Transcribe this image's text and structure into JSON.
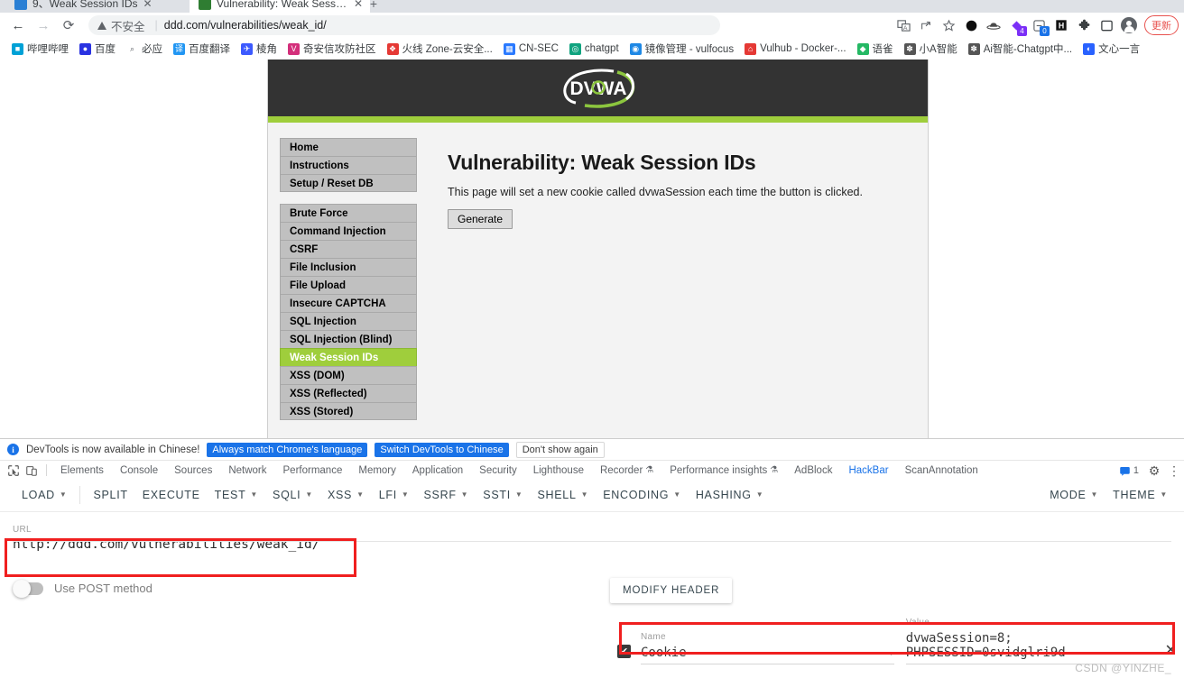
{
  "browser": {
    "tabs": [
      {
        "title": "9、Weak Session IDs",
        "active": false,
        "favicon": "blue-favicon"
      },
      {
        "title": "Vulnerability: Weak Session ID",
        "active": true,
        "favicon": "green-favicon"
      }
    ],
    "new_tab_label": "+",
    "nav": {
      "back": "←",
      "forward": "→",
      "reload": "⟳"
    },
    "omnibox": {
      "security_text": "不安全",
      "divider": "|",
      "url": "ddd.com/vulnerabilities/weak_id/"
    },
    "toolbar_icons": [
      {
        "name": "translate-icon",
        "glyph": "⟨⟩"
      },
      {
        "name": "share-icon",
        "glyph": "↗"
      },
      {
        "name": "bookmark-star-icon",
        "glyph": "☆"
      },
      {
        "name": "extension-opera-icon",
        "glyph": "⬤"
      },
      {
        "name": "extension-hat-icon",
        "glyph": "◝"
      },
      {
        "name": "extension-purple-icon",
        "glyph": "◆",
        "badge": "4",
        "badge_color": "#7b2ff7"
      },
      {
        "name": "extension-scan-icon",
        "glyph": "▦",
        "badge": "0",
        "badge_color": "#1a73e8"
      },
      {
        "name": "extension-hackbar-icon",
        "glyph": "H"
      },
      {
        "name": "extensions-puzzle-icon",
        "glyph": "✻"
      },
      {
        "name": "sidepanel-icon",
        "glyph": "□"
      },
      {
        "name": "profile-avatar",
        "glyph": ""
      }
    ],
    "update_button": "更新",
    "bookmarks": [
      {
        "label": "哔哩哔哩",
        "icon": "bilibili-icon",
        "glyph": "■",
        "color": "#00a1d6"
      },
      {
        "label": "百度",
        "icon": "baidu-icon",
        "glyph": "●",
        "color": "#2932e1"
      },
      {
        "label": "必应",
        "icon": "bing-search-icon",
        "glyph": "⌕",
        "color": "#5f6368"
      },
      {
        "label": "百度翻译",
        "icon": "translate-icon",
        "glyph": "译",
        "color": "#2196f3"
      },
      {
        "label": "棱角",
        "icon": "lengjiao-icon",
        "glyph": "✈",
        "color": "#3d5afe"
      },
      {
        "label": "奇安信攻防社区",
        "icon": "qianxin-icon",
        "glyph": "V",
        "color": "#d32f7b"
      },
      {
        "label": "火线 Zone-云安全...",
        "icon": "huoxian-icon",
        "glyph": "❖",
        "color": "#e53935"
      },
      {
        "label": "CN-SEC",
        "icon": "cnsec-icon",
        "glyph": "▦",
        "color": "#2979ff"
      },
      {
        "label": "chatgpt",
        "icon": "chatgpt-icon",
        "glyph": "◎",
        "color": "#10a37f"
      },
      {
        "label": "镜像管理 - vulfocus",
        "icon": "vulfocus-icon",
        "glyph": "◉",
        "color": "#1e88e5"
      },
      {
        "label": "Vulhub - Docker-...",
        "icon": "vulhub-icon",
        "glyph": "⌂",
        "color": "#e53935"
      },
      {
        "label": "语雀",
        "icon": "yuque-icon",
        "glyph": "◆",
        "color": "#25b864"
      },
      {
        "label": "小A智能",
        "icon": "xiaoa-icon",
        "glyph": "✽",
        "color": "#555555"
      },
      {
        "label": "Ai智能-Chatgpt中...",
        "icon": "ai-chatgpt-icon",
        "glyph": "✽",
        "color": "#555555"
      },
      {
        "label": "文心一言",
        "icon": "wenxin-icon",
        "glyph": "◐",
        "color": "#2962ff"
      }
    ]
  },
  "dvwa": {
    "logo_text": "DVWA",
    "nav_primary": [
      {
        "label": "Home"
      },
      {
        "label": "Instructions"
      },
      {
        "label": "Setup / Reset DB"
      }
    ],
    "nav_vulns": [
      {
        "label": "Brute Force",
        "active": false
      },
      {
        "label": "Command Injection",
        "active": false
      },
      {
        "label": "CSRF",
        "active": false
      },
      {
        "label": "File Inclusion",
        "active": false
      },
      {
        "label": "File Upload",
        "active": false
      },
      {
        "label": "Insecure CAPTCHA",
        "active": false
      },
      {
        "label": "SQL Injection",
        "active": false
      },
      {
        "label": "SQL Injection (Blind)",
        "active": false
      },
      {
        "label": "Weak Session IDs",
        "active": true
      },
      {
        "label": "XSS (DOM)",
        "active": false
      },
      {
        "label": "XSS (Reflected)",
        "active": false
      },
      {
        "label": "XSS (Stored)",
        "active": false
      }
    ],
    "heading": "Vulnerability: Weak Session IDs",
    "description": "This page will set a new cookie called dvwaSession each time the button is clicked.",
    "generate_button": "Generate",
    "accent_green": "#9fce3c",
    "header_dark": "#333333"
  },
  "devtools": {
    "notice": {
      "message": "DevTools is now available in Chinese!",
      "primary_button": "Always match Chrome's language",
      "secondary_button": "Switch DevTools to Chinese",
      "dismiss_button": "Don't show again",
      "info_glyph": "i"
    },
    "left_icons": [
      {
        "name": "inspect-element-icon",
        "glyph": "⬚"
      },
      {
        "name": "device-toolbar-icon",
        "glyph": "◱"
      }
    ],
    "tabs": [
      {
        "label": "Elements",
        "selected": false
      },
      {
        "label": "Console",
        "selected": false
      },
      {
        "label": "Sources",
        "selected": false
      },
      {
        "label": "Network",
        "selected": false
      },
      {
        "label": "Performance",
        "selected": false
      },
      {
        "label": "Memory",
        "selected": false
      },
      {
        "label": "Application",
        "selected": false
      },
      {
        "label": "Security",
        "selected": false
      },
      {
        "label": "Lighthouse",
        "selected": false
      },
      {
        "label": "Recorder",
        "selected": false,
        "suffix": "⚗"
      },
      {
        "label": "Performance insights",
        "selected": false,
        "suffix": "⚗"
      },
      {
        "label": "AdBlock",
        "selected": false
      },
      {
        "label": "HackBar",
        "selected": true
      },
      {
        "label": "ScanAnnotation",
        "selected": false
      }
    ],
    "message_count": "1",
    "settings_glyph": "⚙",
    "more_glyph": "⋮"
  },
  "hackbar": {
    "toolbar": [
      {
        "label": "LOAD",
        "dropdown": true,
        "split_after": true
      },
      {
        "label": "SPLIT",
        "dropdown": false
      },
      {
        "label": "EXECUTE",
        "dropdown": false
      },
      {
        "label": "TEST",
        "dropdown": true
      },
      {
        "label": "SQLI",
        "dropdown": true
      },
      {
        "label": "XSS",
        "dropdown": true
      },
      {
        "label": "LFI",
        "dropdown": true
      },
      {
        "label": "SSRF",
        "dropdown": true
      },
      {
        "label": "SSTI",
        "dropdown": true
      },
      {
        "label": "SHELL",
        "dropdown": true
      },
      {
        "label": "ENCODING",
        "dropdown": true
      },
      {
        "label": "HASHING",
        "dropdown": true
      }
    ],
    "toolbar_right": [
      {
        "label": "MODE",
        "dropdown": true
      },
      {
        "label": "THEME",
        "dropdown": true
      }
    ],
    "url_field": {
      "label": "URL",
      "value": "http://ddd.com/vulnerabilities/weak_id/",
      "highlight_color": "#f01f1f"
    },
    "post_toggle": {
      "label": "Use POST method",
      "enabled": false
    },
    "modify_header": {
      "button_label": "MODIFY HEADER",
      "checked": true,
      "check_glyph": "✔",
      "name_label": "Name",
      "name_value": "Cookie",
      "value_label": "Value",
      "value_value": "dvwaSession=8; PHPSESSID=0svidglri9d",
      "remove_glyph": "✕",
      "dropdown_glyph": "▾",
      "highlight_color": "#f01f1f"
    }
  },
  "watermark": "CSDN @YINZHE_"
}
